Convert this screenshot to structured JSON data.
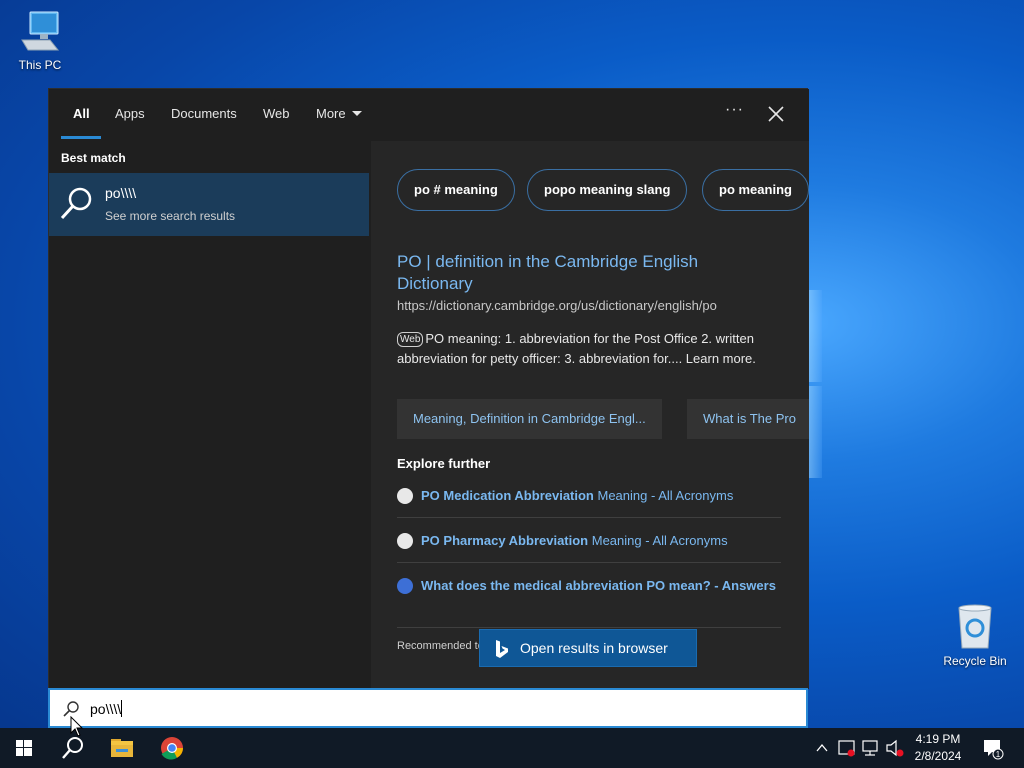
{
  "desktop": {
    "this_pc_label": "This PC",
    "recycle_bin_label": "Recycle Bin"
  },
  "search_panel": {
    "tabs": [
      {
        "label": "All",
        "active": true
      },
      {
        "label": "Apps",
        "active": false
      },
      {
        "label": "Documents",
        "active": false
      },
      {
        "label": "Web",
        "active": false
      },
      {
        "label": "More",
        "active": false
      }
    ],
    "more_options_icon": "ellipsis-icon",
    "close_icon": "close-icon",
    "best_match": {
      "heading": "Best match",
      "title": "po\\\\\\\\",
      "subtitle": "See more search results"
    },
    "suggestion_chips": [
      "po # meaning",
      "popo meaning slang",
      "po meaning"
    ],
    "result": {
      "title": "PO | definition in the Cambridge English Dictionary",
      "url": "https://dictionary.cambridge.org/us/dictionary/english/po",
      "badge": "Web",
      "description": "PO meaning: 1. abbreviation for the Post Office 2. written abbreviation for petty officer: 3. abbreviation for.... Learn more.",
      "sub_links": [
        "Meaning, Definition in Cambridge Engl...",
        "What is The Pro"
      ]
    },
    "explore": {
      "heading": "Explore further",
      "items": [
        {
          "bold": "PO Medication Abbreviation",
          "rest": " Meaning - All Acronyms"
        },
        {
          "bold": "PO Pharmacy Abbreviation",
          "rest": " Meaning - All Acronyms"
        },
        {
          "bold": "What does the medical abbreviation PO mean? - Answers",
          "rest": ""
        }
      ]
    },
    "recommended_text": "Recommended to",
    "open_button_label": "Open results in browser",
    "search_input_value": "po\\\\\\\\"
  },
  "taskbar": {
    "time": "4:19 PM",
    "date": "2/8/2024",
    "notification_count": "1"
  },
  "colors": {
    "accent": "#2a8ad4",
    "link": "#7ab8f0",
    "selected_item_bg": "#1b3c5a",
    "panel_bg": "#1f1f1f",
    "taskbar_bg": "#101a26"
  }
}
